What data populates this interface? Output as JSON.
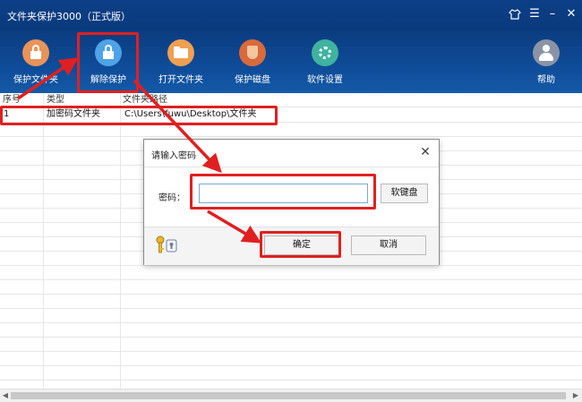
{
  "window": {
    "title": "文件夹保护3000（正式版）"
  },
  "toolbar": {
    "items": [
      {
        "label": "保护文件夹",
        "icon": "lock-icon",
        "color": "#e8935a"
      },
      {
        "label": "解除保护",
        "icon": "lock-icon",
        "color": "#4ea3e6"
      },
      {
        "label": "打开文件夹",
        "icon": "folder-icon",
        "color": "#f0a050"
      },
      {
        "label": "保护磁盘",
        "icon": "shield-icon",
        "color": "#d96a3b"
      },
      {
        "label": "软件设置",
        "icon": "gear-icon",
        "color": "#3fb3a0"
      },
      {
        "label": "帮助",
        "icon": "user-icon",
        "color": "#8a94a6"
      }
    ]
  },
  "table": {
    "headers": [
      "序号",
      "类型",
      "文件夹路径"
    ],
    "rows": [
      [
        "1",
        "加密码文件夹",
        "C:\\Users\\fuwu\\Desktop\\文件夹"
      ]
    ]
  },
  "dialog": {
    "title": "请输入密码",
    "password_label": "密码：",
    "password_value": "",
    "soft_keyboard_label": "软键盘",
    "ok_label": "确定",
    "cancel_label": "取消"
  },
  "colors": {
    "titlebar": "#0c3f86",
    "highlight": "#e02020"
  }
}
